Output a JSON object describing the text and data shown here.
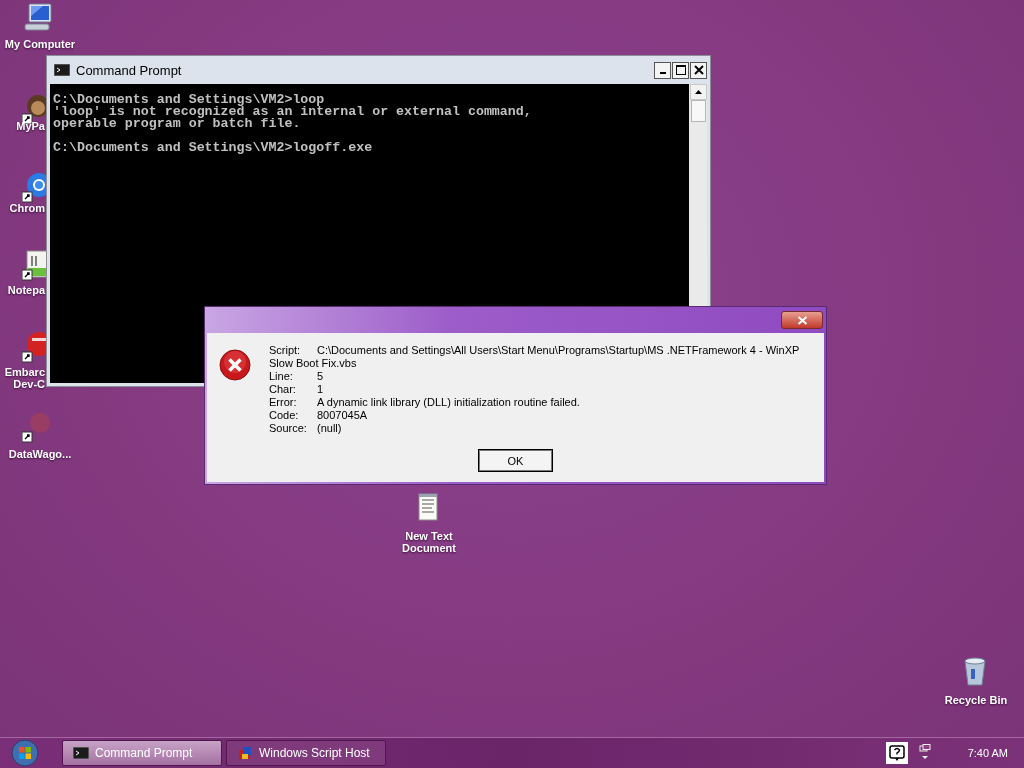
{
  "desktop_icons": [
    {
      "kind": "computer",
      "label": "My Computer",
      "shortcut": false
    },
    {
      "kind": "avatar",
      "label": "MyPa",
      "shortcut": true
    },
    {
      "kind": "browser",
      "label": "Chrom",
      "shortcut": true
    },
    {
      "kind": "notepad",
      "label": "Notepa",
      "shortcut": true
    },
    {
      "kind": "devtool",
      "label": "Embarc",
      "label_2": "Dev-C",
      "shortcut": true
    },
    {
      "kind": "faded",
      "label": "DataWago...",
      "shortcut": true
    },
    {
      "kind": "textfile",
      "label": "New Text",
      "label_2": "Document",
      "shortcut": false
    },
    {
      "kind": "recycle",
      "label": "Recycle Bin",
      "shortcut": false
    }
  ],
  "console_window": {
    "title": "Command Prompt",
    "lines": [
      {
        "text": "C:\\Documents and Settings\\VM2>loop",
        "gap_before": false
      },
      {
        "text": "'loop' is not recognized as an internal or external command,",
        "gap_before": false
      },
      {
        "text": "operable program or batch file.",
        "gap_before": false
      },
      {
        "text": "C:\\Documents and Settings\\VM2>logoff.exe",
        "gap_before": true
      }
    ]
  },
  "error_dialog": {
    "details": [
      {
        "label": "Script:",
        "value": "C:\\Documents and Settings\\All Users\\Start Menu\\Programs\\Startup\\MS .NETFramework 4 - WinXP",
        "continuation": "Slow Boot Fix.vbs"
      },
      {
        "label": "Line:",
        "value": "5"
      },
      {
        "label": "Char:",
        "value": "1"
      },
      {
        "label": "Error:",
        "value": "A dynamic link library (DLL) initialization routine failed."
      },
      {
        "label": "Code:",
        "value": "8007045A"
      },
      {
        "label": "Source:",
        "value": "(null)"
      }
    ],
    "button": "OK"
  },
  "taskbar": {
    "buttons": [
      {
        "label": "Command Prompt",
        "kind": "console",
        "selected": true
      },
      {
        "label": "Windows Script Host",
        "kind": "script",
        "selected": false
      }
    ],
    "clock": "7:40 AM"
  }
}
